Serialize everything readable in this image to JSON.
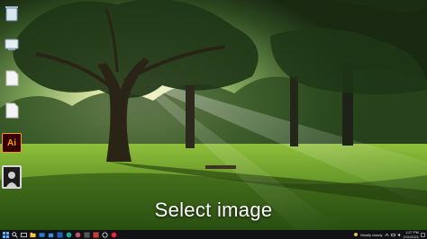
{
  "wallpaper": {
    "name": "tree-in-park-sunrays"
  },
  "overlay": {
    "caption": "Select image"
  },
  "desktop_icons": [
    {
      "name": "recycle-bin-icon"
    },
    {
      "name": "network-drive-icon"
    },
    {
      "name": "blank-file-icon"
    },
    {
      "name": "blank-file-icon"
    },
    {
      "name": "adobe-illustrator-icon",
      "label": "Ai"
    },
    {
      "name": "photo-thumbnail-icon"
    }
  ],
  "taskbar": {
    "start_icon": "windows-start-icon",
    "pinned": [
      "search-icon",
      "task-view-icon",
      "file-explorer-icon",
      "mail-icon",
      "store-icon",
      "word-icon",
      "edge-icon",
      "chrome-icon",
      "photos-icon",
      "media-icon",
      "settings-icon",
      "opera-icon"
    ],
    "tray": {
      "weather": "Mostly cloudy",
      "clock_time": "1:27 PM",
      "clock_date": "2/11/2021"
    }
  },
  "colors": {
    "taskbar_bg": "#101215",
    "caption_text": "#ffffff",
    "illustrator_bg": "#330000",
    "illustrator_text": "#ff9a00"
  }
}
